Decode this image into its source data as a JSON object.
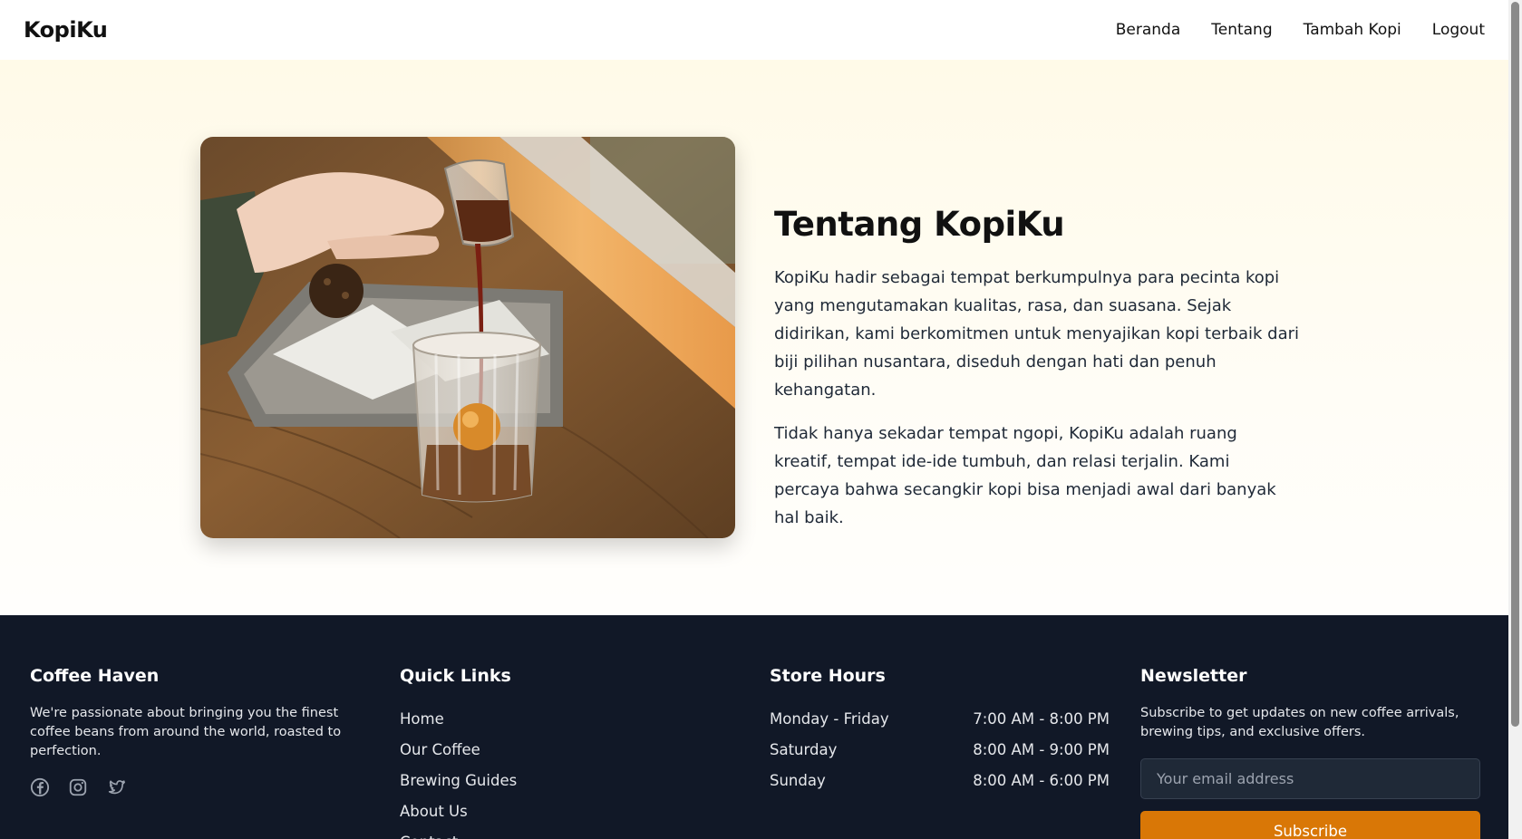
{
  "navbar": {
    "brand": "KopiKu",
    "links": [
      {
        "label": "Beranda"
      },
      {
        "label": "Tentang"
      },
      {
        "label": "Tambah Kopi"
      },
      {
        "label": "Logout"
      }
    ]
  },
  "about": {
    "image_alt": "Kopi dituang ke gelas",
    "title": "Tentang KopiKu",
    "paragraphs": [
      "KopiKu hadir sebagai tempat berkumpulnya para pecinta kopi yang mengutamakan kualitas, rasa, dan suasana. Sejak didirikan, kami berkomitmen untuk menyajikan kopi terbaik dari biji pilihan nusantara, diseduh dengan hati dan penuh kehangatan.",
      "Tidak hanya sekadar tempat ngopi, KopiKu adalah ruang kreatif, tempat ide-ide tumbuh, dan relasi terjalin. Kami percaya bahwa secangkir kopi bisa menjadi awal dari banyak hal baik."
    ]
  },
  "footer": {
    "about": {
      "heading": "Coffee Haven",
      "description": "We're passionate about bringing you the finest coffee beans from around the world, roasted to perfection.",
      "social_icons": [
        "facebook-icon",
        "instagram-icon",
        "twitter-icon"
      ]
    },
    "quick_links": {
      "heading": "Quick Links",
      "items": [
        "Home",
        "Our Coffee",
        "Brewing Guides",
        "About Us",
        "Contact"
      ]
    },
    "store_hours": {
      "heading": "Store Hours",
      "rows": [
        {
          "day": "Monday - Friday",
          "time": "7:00 AM - 8:00 PM"
        },
        {
          "day": "Saturday",
          "time": "8:00 AM - 9:00 PM"
        },
        {
          "day": "Sunday",
          "time": "8:00 AM - 6:00 PM"
        }
      ]
    },
    "newsletter": {
      "heading": "Newsletter",
      "description": "Subscribe to get updates on new coffee arrivals, brewing tips, and exclusive offers.",
      "email_value": "",
      "email_placeholder": "Your email address",
      "button_label": "Subscribe"
    }
  },
  "colors": {
    "footer_bg": "#111827",
    "accent": "#d97706",
    "hero_bg": "#fffae8"
  }
}
